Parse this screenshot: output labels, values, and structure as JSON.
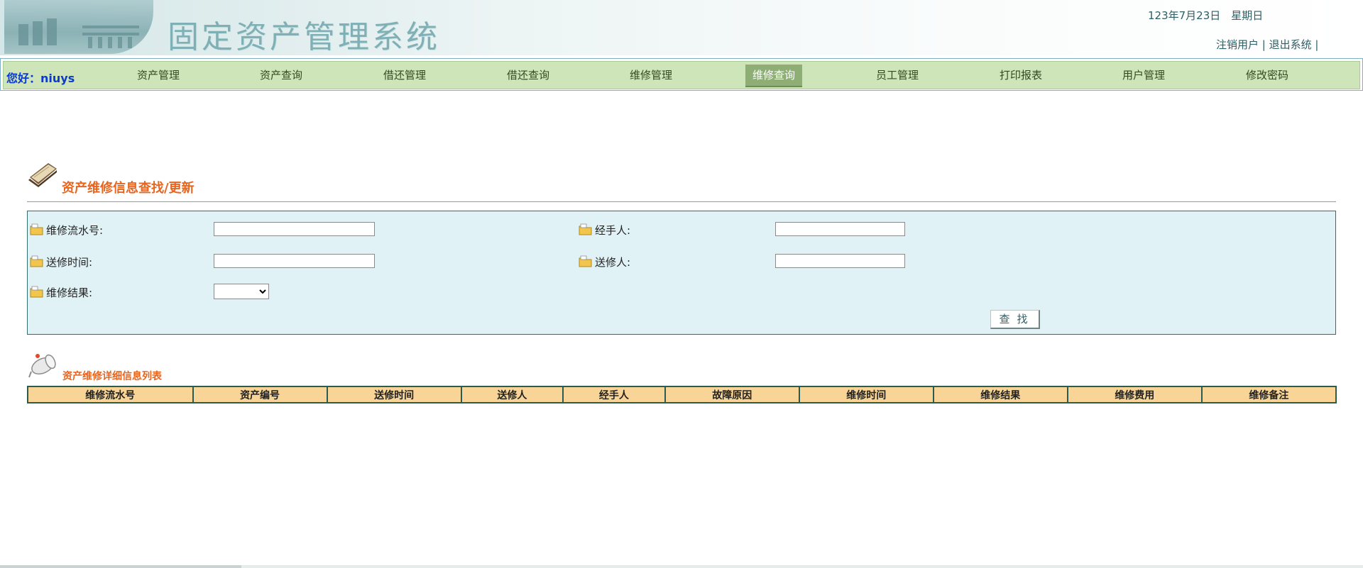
{
  "app": {
    "title": "固定资产管理系统",
    "date": "123年7月23日　星期日",
    "links": [
      "注销用户",
      "退出系统"
    ]
  },
  "nav": {
    "greeting": "您好：niuys",
    "items": [
      "资产管理",
      "资产查询",
      "借还管理",
      "借还查询",
      "维修管理",
      "维修查询",
      "员工管理",
      "打印报表",
      "用户管理",
      "修改密码"
    ],
    "active": "维修查询"
  },
  "search": {
    "title": "资产维修信息查找/更新",
    "fields": {
      "serial_label": "维修流水号:",
      "serial_value": "",
      "handler_label": "经手人:",
      "handler_value": "",
      "send_time_label": "送修时间:",
      "send_time_value": "",
      "sender_label": "送修人:",
      "sender_value": "",
      "result_label": "维修结果:",
      "result_value": ""
    },
    "button": "查找"
  },
  "list": {
    "title": "资产维修详细信息列表",
    "columns": [
      "维修流水号",
      "资产编号",
      "送修时间",
      "送修人",
      "经手人",
      "故障原因",
      "维修时间",
      "维修结果",
      "维修费用",
      "维修备注"
    ]
  },
  "colors": {
    "nav_bg": "#cde5b8",
    "nav_active": "#8fae76",
    "accent_orange": "#e8651f",
    "panel_bg": "#e1f2f6",
    "table_header_bg": "#f8d596",
    "greeting_blue": "#0b3ad1"
  },
  "icons": [
    "building-logo-icon",
    "book-icon",
    "folder-icon",
    "megaphone-icon"
  ]
}
